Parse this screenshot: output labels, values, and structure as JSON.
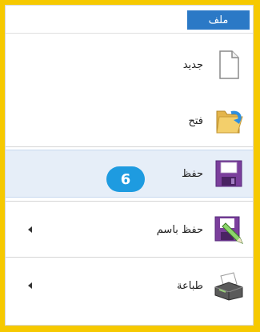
{
  "menu": {
    "file_tab": "ملف",
    "items": [
      {
        "label": "جديد",
        "icon": "new-document-icon"
      },
      {
        "label": "فتح",
        "icon": "open-folder-icon"
      },
      {
        "label": "حفظ",
        "icon": "save-icon"
      },
      {
        "label": "حفظ باسم",
        "icon": "save-as-icon"
      },
      {
        "label": "طباعة",
        "icon": "printer-icon"
      }
    ]
  },
  "callout": {
    "number": "6"
  },
  "colors": {
    "accent": "#2b79c6",
    "highlight": "#e6eef8",
    "border": "#f6c900",
    "badge": "#1e9be0"
  }
}
